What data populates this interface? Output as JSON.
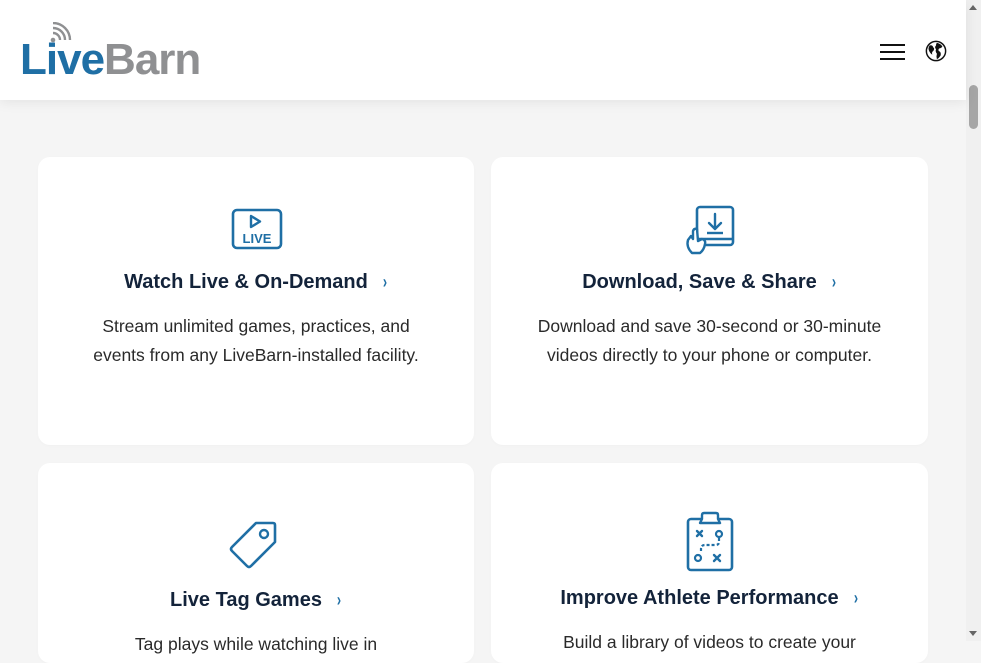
{
  "header": {
    "logo": {
      "part1": "Live",
      "part2": "Barn"
    }
  },
  "colors": {
    "brand_blue": "#1f6fa5",
    "logo_gray": "#8f9092",
    "title": "#13233a"
  },
  "icons": {
    "menu": "hamburger-menu-icon",
    "language": "globe-icon"
  },
  "cards": [
    {
      "icon": "live-video-icon",
      "icon_text": "LIVE",
      "title": "Watch Live & On-Demand",
      "chevron": "›",
      "description": "Stream unlimited games, practices, and events from any LiveBarn-installed facility."
    },
    {
      "icon": "download-tablet-icon",
      "title": "Download, Save & Share",
      "chevron": "›",
      "description": "Download and save 30-second or 30-minute videos directly to your phone or computer."
    },
    {
      "icon": "tag-icon",
      "title": "Live Tag Games",
      "chevron": "›",
      "description": "Tag plays while watching live in"
    },
    {
      "icon": "clipboard-playbook-icon",
      "title": "Improve Athlete Performance",
      "chevron": "›",
      "description": "Build a library of videos to create your"
    }
  ]
}
